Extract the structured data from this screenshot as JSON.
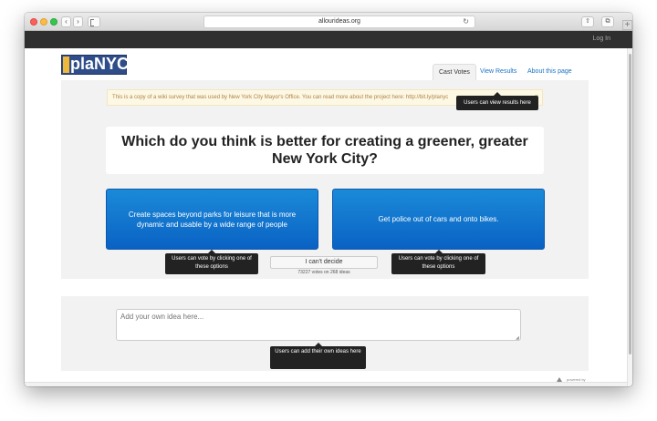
{
  "browser": {
    "url": "allourideas.org",
    "back_glyph": "‹",
    "forward_glyph": "›",
    "reload_glyph": "↻",
    "share_glyph": "⇧",
    "tabs_glyph": "⧉",
    "new_tab_glyph": "+"
  },
  "topbar": {
    "login_label": "Log In"
  },
  "logo": {
    "text": "plaNYC"
  },
  "tabs": [
    {
      "label": "Cast Votes"
    },
    {
      "label": "View Results"
    },
    {
      "label": "About this page"
    }
  ],
  "banner": {
    "text": "This is a copy of a wiki survey that was used by New York City Mayor's Office. You can read more about the project here: http://bit.ly/planyc",
    "close_label": "×"
  },
  "question": "Which do you think is better for creating a greener, greater New York City?",
  "choices": {
    "left": "Create spaces beyond parks for leisure that is more dynamic and usable by a wide range of people",
    "right": "Get police out of cars and onto bikes."
  },
  "cant_decide_label": "I can't decide",
  "votes_text": "73227 votes on 268 ideas",
  "tooltips": {
    "results": "Users can view results here",
    "vote_left": "Users can vote by clicking one of these options",
    "vote_right": "Users can vote by clicking one of these options",
    "add_idea": "Users can add their own ideas here"
  },
  "idea_input": {
    "placeholder": "Add your own idea here..."
  },
  "footer": {
    "powered_by": "powered by"
  },
  "colors": {
    "accent": "#0a62c4",
    "topbar": "#2f2f2f",
    "banner_bg": "#fcf8e3",
    "logo_bg": "#2e4d89"
  }
}
